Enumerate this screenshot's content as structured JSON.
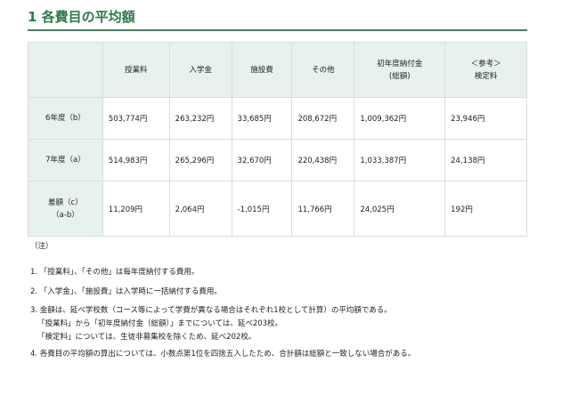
{
  "title": "1 各費目の平均額",
  "table": {
    "headers": [
      "",
      "授業料",
      "入学金",
      "施設費",
      "その他",
      "初年度納付金",
      "(総額)",
      "＜参考＞",
      "検定料"
    ],
    "rows": [
      {
        "label": "6年度（b）",
        "label2": "",
        "values": [
          "503,774円",
          "263,232円",
          "33,685円",
          "208,672円",
          "1,009,362円",
          "23,946円"
        ]
      },
      {
        "label": "7年度（a）",
        "label2": "",
        "values": [
          "514,983円",
          "265,296円",
          "32,670円",
          "220,438円",
          "1,033,387円",
          "24,138円"
        ]
      },
      {
        "label": "差額（c）",
        "label2": "（a-b）",
        "values": [
          "11,209円",
          "2,064円",
          "-1,015円",
          "11,766円",
          "24,025円",
          "192円"
        ]
      }
    ]
  },
  "notes": {
    "heading": "（注）",
    "items": [
      "1. 「授業料」、「その他」は毎年度納付する費用。",
      "2. 「入学金」、「施設費」は入学時に一括納付する費用。",
      "3. 金額は、延べ学校数（コース等によって学費が異なる場合はそれぞれ1校として計算）の平均額である。",
      "「授業料」から「初年度納付金（総額）」までについては、延べ203校。",
      "「検定料」については、生徒非募集校を除くため、延べ202校。",
      "4. 各費目の平均額の算出については、小数点第1位を四捨五入したため、合計額は総額と一致しない場合がある。"
    ]
  }
}
